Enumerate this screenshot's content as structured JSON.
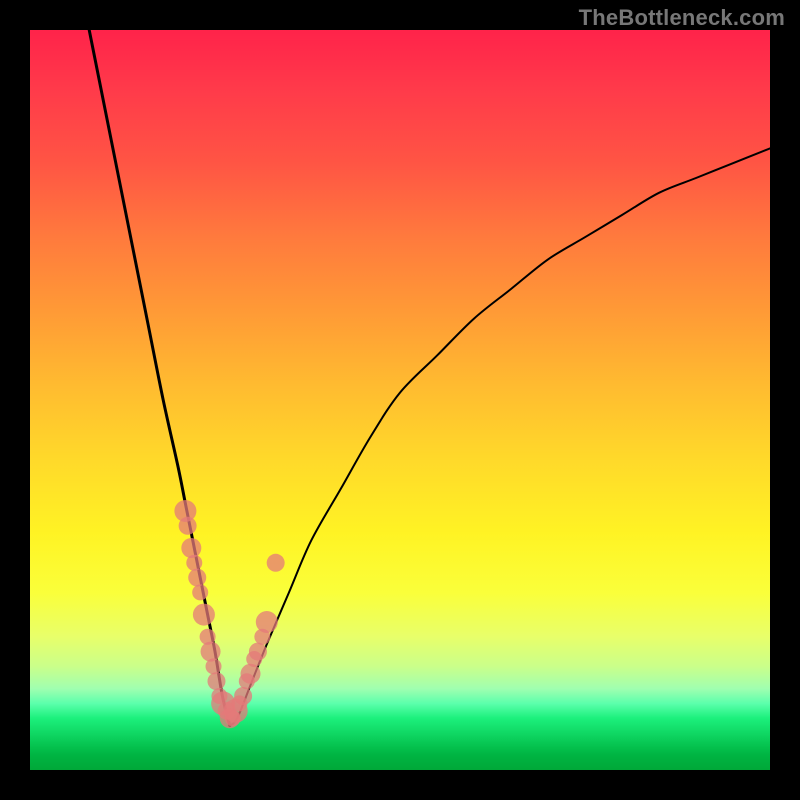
{
  "watermark": "TheBottleneck.com",
  "colors": {
    "frame": "#000000",
    "curve": "#000000",
    "marker": "#e47a7a",
    "marker_alpha": 0.75
  },
  "chart_data": {
    "type": "line",
    "title": "",
    "xlabel": "",
    "ylabel": "",
    "xlim": [
      0,
      100
    ],
    "ylim": [
      0,
      100
    ],
    "grid": false,
    "legend": false,
    "note": "V-shaped bottleneck curve; vertex near x≈27. Left branch: steep descent from (8,100) to (27,6). Right branch: rises from (27,6) toward (100,84). Scatter markers cluster on both branches near the vertex.",
    "series": [
      {
        "name": "curve-left",
        "x": [
          8,
          10,
          12,
          14,
          16,
          18,
          20,
          21,
          22,
          23,
          24,
          25,
          26,
          27
        ],
        "y": [
          100,
          90,
          80,
          70,
          60,
          50,
          41,
          36,
          31,
          26,
          21,
          16,
          10,
          6
        ]
      },
      {
        "name": "curve-right",
        "x": [
          27,
          28,
          30,
          32,
          35,
          38,
          42,
          46,
          50,
          55,
          60,
          65,
          70,
          75,
          80,
          85,
          90,
          95,
          100
        ],
        "y": [
          6,
          7,
          12,
          17,
          24,
          31,
          38,
          45,
          51,
          56,
          61,
          65,
          69,
          72,
          75,
          78,
          80,
          82,
          84
        ]
      }
    ],
    "scatter": {
      "name": "data-points",
      "x": [
        21.0,
        21.3,
        21.8,
        22.2,
        22.6,
        23.0,
        23.5,
        24.0,
        24.4,
        24.8,
        25.2,
        25.6,
        26.1,
        26.6,
        27.0,
        27.4,
        27.8,
        28.3,
        28.8,
        29.3,
        29.8,
        30.3,
        30.8,
        31.4,
        32.0,
        33.2
      ],
      "y": [
        35,
        33,
        30,
        28,
        26,
        24,
        21,
        18,
        16,
        14,
        12,
        10,
        9,
        8,
        7,
        7,
        8,
        9,
        10,
        12,
        13,
        15,
        16,
        18,
        20,
        28
      ],
      "r": [
        11,
        9,
        10,
        8,
        9,
        8,
        11,
        8,
        10,
        8,
        9,
        8,
        12,
        9,
        10,
        8,
        12,
        8,
        9,
        8,
        10,
        8,
        9,
        8,
        11,
        9
      ]
    }
  }
}
